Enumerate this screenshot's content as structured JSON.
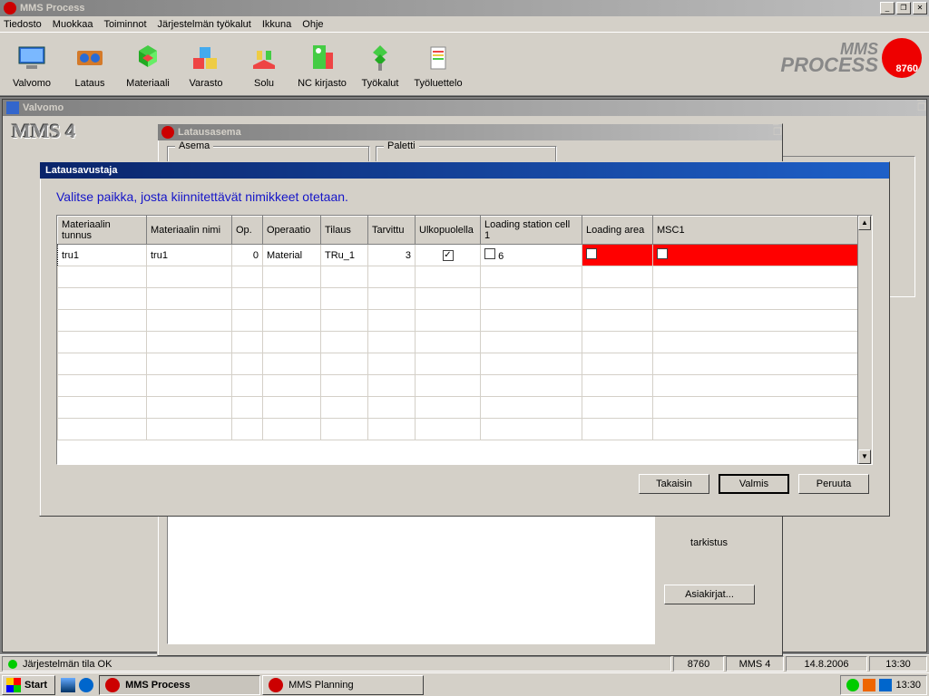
{
  "main_window": {
    "title": "MMS Process"
  },
  "menu": {
    "tiedosto": "Tiedosto",
    "muokkaa": "Muokkaa",
    "toiminnot": "Toiminnot",
    "jarjestelman": "Järjestelmän työkalut",
    "ikkuna": "Ikkuna",
    "ohje": "Ohje"
  },
  "toolbar": {
    "valvomo": "Valvomo",
    "lataus": "Lataus",
    "materiaali": "Materiaali",
    "varasto": "Varasto",
    "solu": "Solu",
    "nc": "NC kirjasto",
    "tyokalut": "Työkalut",
    "tyoluettelo": "Työluettelo"
  },
  "brand": {
    "line1": "MMS",
    "line2": "PROCESS",
    "badge": "8760"
  },
  "valvomo_win": {
    "title": "Valvomo",
    "mms4": "MMS 4"
  },
  "lataus_win": {
    "title": "Latausasema",
    "fs_asema": "Asema",
    "fs_paletti": "Paletti",
    "tarkistus_label": "tarkistus",
    "asiakirjat_btn": "Asiakirjat..."
  },
  "modal": {
    "title": "Latausavustaja",
    "instruction": "Valitse paikka, josta kiinnitettävät nimikkeet otetaan.",
    "columns": {
      "c0": "Materiaalin tunnus",
      "c1": "Materiaalin nimi",
      "c2": "Op.",
      "c3": "Operaatio",
      "c4": "Tilaus",
      "c5": "Tarvittu",
      "c6": "Ulkopuolella",
      "c7": "Loading station cell 1",
      "c8": "Loading area",
      "c9": "MSC1"
    },
    "row": {
      "tunnus": "tru1",
      "nimi": "tru1",
      "op": "0",
      "operaatio": "Material",
      "tilaus": "TRu_1",
      "tarvittu": "3",
      "cell1": "6"
    },
    "btn_takaisin": "Takaisin",
    "btn_valmis": "Valmis",
    "btn_peruuta": "Peruuta"
  },
  "statusbar": {
    "led_ok": true,
    "status": "Järjestelmän tila OK",
    "num": "8760",
    "sys": "MMS 4",
    "date": "14.8.2006",
    "time": "13:30"
  },
  "taskbar": {
    "start": "Start",
    "task1": "MMS Process",
    "task2": "MMS Planning",
    "clock": "13:30"
  }
}
